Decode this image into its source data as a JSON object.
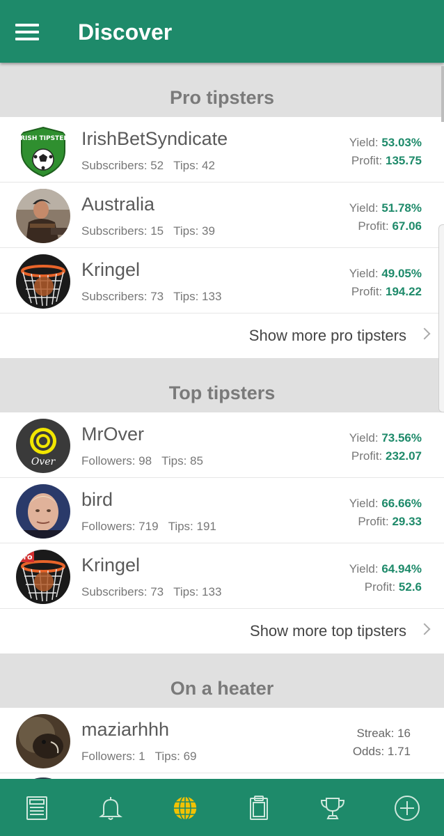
{
  "header": {
    "title": "Discover"
  },
  "colors": {
    "primary": "#1e8a6a",
    "value": "#1e8a6a",
    "active_nav": "#f2c200"
  },
  "pro": {
    "title": "Pro tipsters",
    "more": "Show more pro tipsters",
    "rows": [
      {
        "name": "IrishBetSyndicate",
        "count_label": "Subscribers: 52",
        "tips": "Tips: 42",
        "yield_label": "Yield:",
        "yield": "53.03%",
        "profit_label": "Profit:",
        "profit": "135.75"
      },
      {
        "name": "Australia",
        "count_label": "Subscribers: 15",
        "tips": "Tips: 39",
        "yield_label": "Yield:",
        "yield": "51.78%",
        "profit_label": "Profit:",
        "profit": "67.06"
      },
      {
        "name": "Kringel",
        "count_label": "Subscribers: 73",
        "tips": "Tips: 133",
        "yield_label": "Yield:",
        "yield": "49.05%",
        "profit_label": "Profit:",
        "profit": "194.22"
      }
    ]
  },
  "top": {
    "title": "Top tipsters",
    "more": "Show more top tipsters",
    "rows": [
      {
        "name": "MrOver",
        "count_label": "Followers: 98",
        "tips": "Tips: 85",
        "yield_label": "Yield:",
        "yield": "73.56%",
        "profit_label": "Profit:",
        "profit": "232.07"
      },
      {
        "name": "bird",
        "count_label": "Followers: 719",
        "tips": "Tips: 191",
        "yield_label": "Yield:",
        "yield": "66.66%",
        "profit_label": "Profit:",
        "profit": "29.33"
      },
      {
        "name": "Kringel",
        "count_label": "Subscribers: 73",
        "tips": "Tips: 133",
        "yield_label": "Yield:",
        "yield": "64.94%",
        "profit_label": "Profit:",
        "profit": "52.6"
      }
    ]
  },
  "heater": {
    "title": "On a heater",
    "rows": [
      {
        "name": "maziarhhh",
        "count_label": "Followers: 1",
        "tips": "Tips: 69",
        "streak": "Streak: 16",
        "odds": "Odds: 1.71"
      }
    ]
  },
  "avatar_text": {
    "irish_logo": "IRISH TIPSTER",
    "over_logo": "Over",
    "pro_badge": "Pro"
  },
  "nav": [
    "news-icon",
    "bell-icon",
    "globe-icon",
    "clipboard-icon",
    "trophy-icon",
    "add-icon"
  ]
}
